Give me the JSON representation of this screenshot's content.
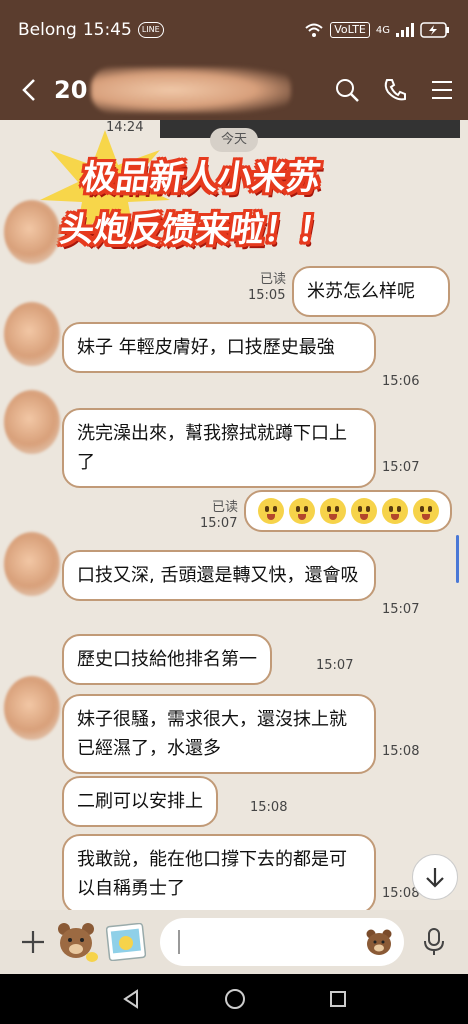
{
  "status": {
    "carrier": "Belong",
    "time": "15:45",
    "app_badge": "LINE",
    "volte": "VoLTE",
    "network": "4G"
  },
  "header": {
    "title_visible": "20"
  },
  "chat": {
    "top_partial_time": "14:24",
    "date_divider": "今天",
    "banner_line1": "极品新人小米苏",
    "banner_line2": "头炮反馈来啦！！",
    "messages": [
      {
        "side": "right",
        "text": "米苏怎么样呢",
        "read": "已读",
        "time": "15:05"
      },
      {
        "side": "left",
        "text": "妹子 年輕皮膚好，口技歷史最強",
        "time": "15:06"
      },
      {
        "side": "left",
        "text": "洗完澡出來，幫我擦拭就蹲下口上了",
        "time": "15:07"
      },
      {
        "side": "right",
        "text": "",
        "read": "已读",
        "time": "15:07"
      },
      {
        "side": "left",
        "text": "口技又深, 舌頭還是轉又快，還會吸",
        "time": "15:07"
      },
      {
        "side": "left",
        "text": "歷史口技給他排名第一",
        "time": "15:07"
      },
      {
        "side": "left",
        "text": "妹子很騷，需求很大，還沒抹上就已經濕了，水還多",
        "time": "15:08"
      },
      {
        "side": "left",
        "text": "二刷可以安排上",
        "time": "15:08"
      },
      {
        "side": "left",
        "text": "我敢說，能在他口撐下去的都是可以自稱勇士了",
        "time": "15:08"
      }
    ]
  },
  "icons": {
    "back": "chevron-left-icon",
    "search": "search-icon",
    "call": "phone-icon",
    "menu": "menu-icon",
    "scroll_down": "arrow-down-icon",
    "add": "plus-icon",
    "sticker": "bear-sticker-icon",
    "gallery": "image-icon",
    "emoji": "bear-face-icon",
    "mic": "microphone-icon"
  },
  "colors": {
    "header_bg": "#5b3d2e",
    "chat_bg": "#ece6dd",
    "bubble_border": "#c19a77",
    "banner_red": "#e63a1e"
  }
}
